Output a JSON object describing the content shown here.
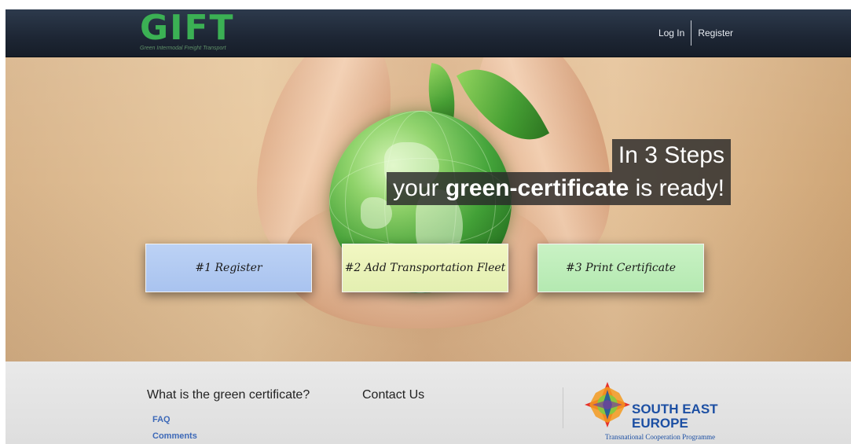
{
  "header": {
    "logo_text": "GIFT",
    "logo_tagline": "Green Intermodal Freight Transport",
    "nav": {
      "login_label": "Log In",
      "register_label": "Register"
    }
  },
  "hero": {
    "headline_line1": "In 3 Steps",
    "headline_prefix": "your ",
    "headline_bold": "green-certificate",
    "headline_suffix": " is ready!",
    "steps": [
      {
        "label": "#1 Register",
        "color": "#b3cbf2"
      },
      {
        "label": "#2 Add Transportation Fleet",
        "color": "#eaf3b9"
      },
      {
        "label": "#3 Print Certificate",
        "color": "#bfeeba"
      }
    ]
  },
  "footer": {
    "section_title": "What is the green certificate?",
    "contact_label": "Contact Us",
    "links": [
      "FAQ",
      "Comments"
    ],
    "partner": {
      "line1": "SOUTH EAST",
      "line2": "EUROPE",
      "subtitle": "Transnational Cooperation Programme"
    }
  },
  "colors": {
    "brand_green": "#3bb054",
    "nav_bg": "#1d2634",
    "link_blue": "#3d69b8",
    "partner_blue": "#1c4fa3"
  }
}
